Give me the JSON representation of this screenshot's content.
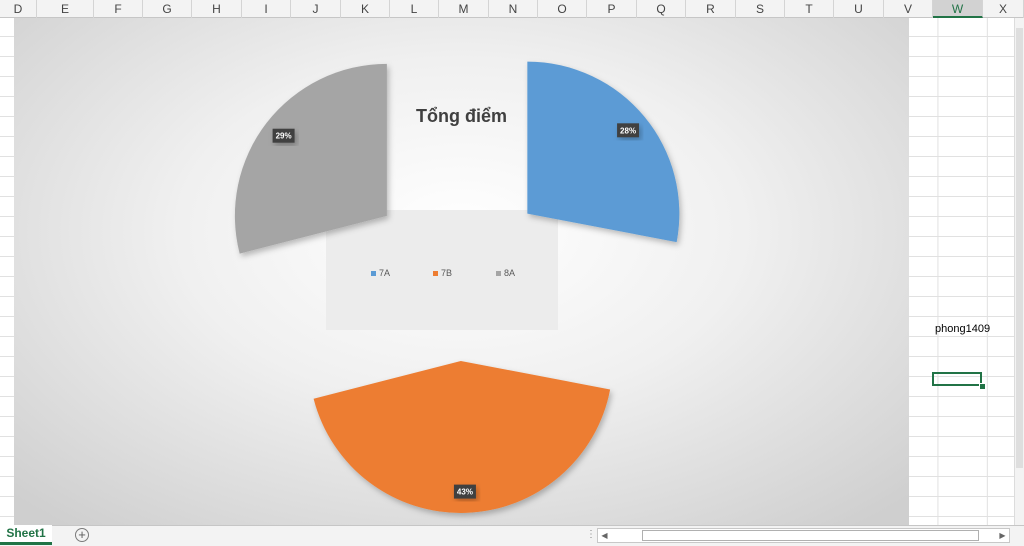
{
  "columns": [
    "D",
    "E",
    "F",
    "G",
    "H",
    "I",
    "J",
    "K",
    "L",
    "M",
    "N",
    "O",
    "P",
    "Q",
    "R",
    "S",
    "T",
    "U",
    "V",
    "W",
    "X"
  ],
  "selected_column": "W",
  "chart": {
    "title": "Tổng điểm",
    "legend": [
      {
        "label": "7A",
        "color": "#5b9bd5"
      },
      {
        "label": "7B",
        "color": "#ed7d31"
      },
      {
        "label": "8A",
        "color": "#a5a5a5"
      }
    ]
  },
  "chart_data": {
    "type": "pie",
    "title": "Tổng điểm",
    "categories": [
      "7A",
      "7B",
      "8A"
    ],
    "values": [
      28,
      43,
      29
    ],
    "data_labels": [
      "28%",
      "43%",
      "29%"
    ],
    "colors": [
      "#5b9bd5",
      "#ed7d31",
      "#a5a5a5"
    ],
    "exploded": true,
    "legend_position": "center"
  },
  "cell_text": "phong1409",
  "sheet_tab": "Sheet1",
  "icons": {
    "add_sheet": "plus-circle-icon",
    "scroll_left": "triangle-left-icon",
    "scroll_right": "triangle-right-icon"
  }
}
